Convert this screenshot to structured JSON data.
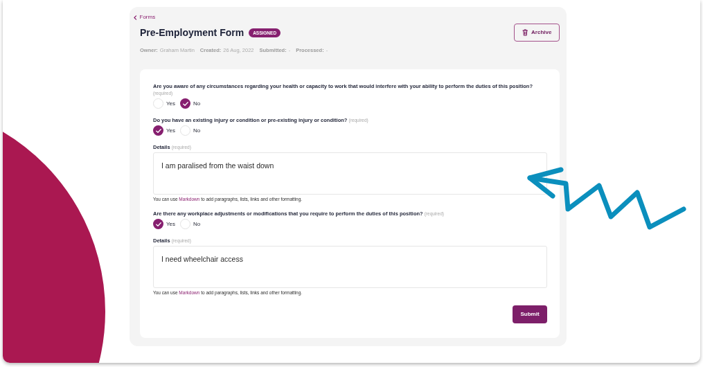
{
  "breadcrumb": {
    "label": "Forms"
  },
  "header": {
    "title": "Pre-Employment Form",
    "status": "ASSIGNED",
    "archive_button": "Archive"
  },
  "meta": [
    {
      "label": "Owner:",
      "value": "Graham Martin"
    },
    {
      "label": "Created:",
      "value": "26 Aug, 2022"
    },
    {
      "label": "Submitted:",
      "value": "-"
    },
    {
      "label": "Processed:",
      "value": "-"
    }
  ],
  "fields": [
    {
      "kind": "radio",
      "label": "Are you aware of any circumstances regarding your health or capacity to work that would interfere with your ability to perform the duties of this position?",
      "note": "(required)",
      "options": [
        {
          "label": "Yes",
          "selected": false
        },
        {
          "label": "No",
          "selected": true
        }
      ]
    },
    {
      "kind": "radio",
      "label": "Do you have an existing injury or condition or pre-existing injury or condition?",
      "note": "(required)",
      "options": [
        {
          "label": "Yes",
          "selected": true
        },
        {
          "label": "No",
          "selected": false
        }
      ]
    },
    {
      "kind": "textarea",
      "label": "Details",
      "note": "(required)",
      "value": "I am paralised from the waist down",
      "help": {
        "before": "You can use",
        "link": "Markdown",
        "after": "to add paragraphs, lists, links and other formatting."
      }
    },
    {
      "kind": "radio",
      "label": "Are there any workplace adjustments or modifications that you require to perform the duties of this position?",
      "note": "(required)",
      "options": [
        {
          "label": "Yes",
          "selected": true
        },
        {
          "label": "No",
          "selected": false
        }
      ]
    },
    {
      "kind": "textarea",
      "label": "Details",
      "note": "(required)",
      "value": "I need wheelchair access",
      "help": {
        "before": "You can use",
        "link": "Markdown",
        "after": "to add paragraphs, lists, links and other formatting."
      }
    }
  ],
  "submit_button": "Submit"
}
